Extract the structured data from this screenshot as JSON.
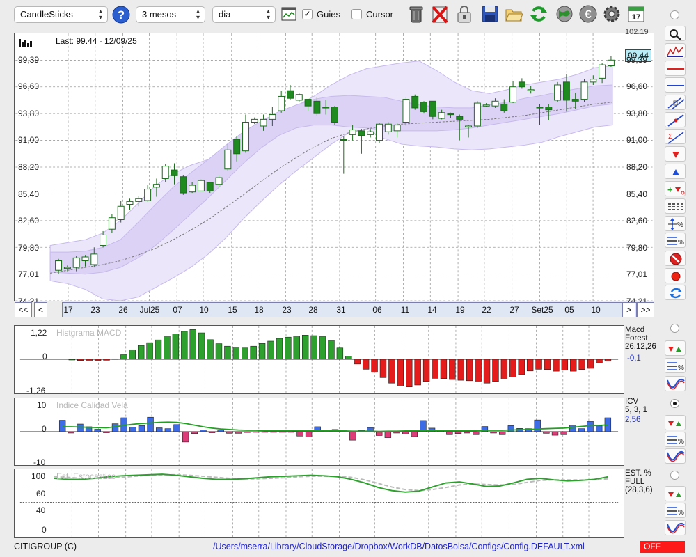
{
  "toolbar": {
    "chart_type": "CandleSticks",
    "period": "3 mesos",
    "interval": "dia",
    "guides_label": "Guies",
    "guides_checked": true,
    "cursor_label": "Cursor",
    "cursor_checked": false,
    "icons": [
      "help-icon",
      "chart-window-icon",
      "trash-icon",
      "delete-icon",
      "lock-icon",
      "save-icon",
      "open-folder-icon",
      "refresh-icon",
      "globe-icon",
      "euro-icon",
      "gear-icon",
      "calendar-icon"
    ],
    "calendar_day": "17"
  },
  "price_chart": {
    "last_info": "Last: 99.44 - 12/09/25",
    "current_value": "99,44",
    "top_cut_label": "102,19",
    "y_labels": [
      "99,39",
      "96,60",
      "93,80",
      "91,00",
      "88,20",
      "85,40",
      "82,60",
      "79,80",
      "77,01",
      "74,21"
    ],
    "ylim": [
      74.21,
      102.19
    ],
    "x_labels": [
      "17",
      "23",
      "26",
      "Jul25",
      "07",
      "10",
      "15",
      "18",
      "23",
      "28",
      "31",
      "06",
      "11",
      "14",
      "19",
      "22",
      "27",
      "Set25",
      "05",
      "10"
    ],
    "nav": {
      "first": "<<",
      "prev": "<",
      "next": ">",
      "last": ">>"
    },
    "candles": [
      {
        "o": 77.4,
        "h": 78.6,
        "l": 77.0,
        "c": 78.4
      },
      {
        "o": 77.6,
        "h": 77.9,
        "l": 77.3,
        "c": 77.7
      },
      {
        "o": 77.7,
        "h": 78.9,
        "l": 77.3,
        "c": 78.7
      },
      {
        "o": 78.4,
        "h": 79.0,
        "l": 77.8,
        "c": 78.8
      },
      {
        "o": 78.0,
        "h": 79.8,
        "l": 77.7,
        "c": 79.1
      },
      {
        "o": 80.0,
        "h": 81.5,
        "l": 79.8,
        "c": 81.1
      },
      {
        "o": 81.7,
        "h": 83.3,
        "l": 81.3,
        "c": 82.9
      },
      {
        "o": 82.7,
        "h": 84.7,
        "l": 82.4,
        "c": 84.1
      },
      {
        "o": 84.3,
        "h": 84.9,
        "l": 83.7,
        "c": 84.6
      },
      {
        "o": 84.6,
        "h": 85.2,
        "l": 84.1,
        "c": 84.9
      },
      {
        "o": 84.7,
        "h": 86.3,
        "l": 84.6,
        "c": 85.9
      },
      {
        "o": 86.1,
        "h": 87.0,
        "l": 85.1,
        "c": 86.4
      },
      {
        "o": 87.0,
        "h": 88.5,
        "l": 86.6,
        "c": 88.3
      },
      {
        "o": 87.9,
        "h": 88.6,
        "l": 86.4,
        "c": 87.3
      },
      {
        "o": 87.2,
        "h": 87.4,
        "l": 85.3,
        "c": 85.5
      },
      {
        "o": 85.6,
        "h": 86.6,
        "l": 85.5,
        "c": 86.3
      },
      {
        "o": 85.7,
        "h": 86.9,
        "l": 85.7,
        "c": 86.8
      },
      {
        "o": 86.6,
        "h": 86.6,
        "l": 85.5,
        "c": 85.7
      },
      {
        "o": 86.4,
        "h": 87.3,
        "l": 86.1,
        "c": 87.1
      },
      {
        "o": 88.0,
        "h": 90.6,
        "l": 87.8,
        "c": 90.0
      },
      {
        "o": 91.1,
        "h": 91.4,
        "l": 88.8,
        "c": 89.6
      },
      {
        "o": 89.9,
        "h": 93.7,
        "l": 89.7,
        "c": 92.9
      },
      {
        "o": 92.9,
        "h": 93.4,
        "l": 92.7,
        "c": 93.2
      },
      {
        "o": 92.5,
        "h": 93.7,
        "l": 92.0,
        "c": 93.2
      },
      {
        "o": 93.2,
        "h": 94.5,
        "l": 92.5,
        "c": 93.7
      },
      {
        "o": 94.1,
        "h": 96.2,
        "l": 93.9,
        "c": 95.6
      },
      {
        "o": 96.2,
        "h": 96.8,
        "l": 95.2,
        "c": 95.4
      },
      {
        "o": 95.2,
        "h": 96.0,
        "l": 95.0,
        "c": 95.8
      },
      {
        "o": 95.3,
        "h": 95.3,
        "l": 94.1,
        "c": 94.6
      },
      {
        "o": 95.1,
        "h": 95.5,
        "l": 93.6,
        "c": 93.8
      },
      {
        "o": 94.5,
        "h": 95.2,
        "l": 93.7,
        "c": 94.4
      },
      {
        "o": 94.5,
        "h": 94.6,
        "l": 92.6,
        "c": 92.9
      },
      {
        "o": 91.1,
        "h": 91.4,
        "l": 87.5,
        "c": 91.0
      },
      {
        "o": 91.6,
        "h": 92.6,
        "l": 91.0,
        "c": 92.1
      },
      {
        "o": 92.0,
        "h": 92.2,
        "l": 89.6,
        "c": 91.5
      },
      {
        "o": 91.6,
        "h": 92.2,
        "l": 91.3,
        "c": 91.9
      },
      {
        "o": 91.0,
        "h": 92.8,
        "l": 90.7,
        "c": 92.7
      },
      {
        "o": 91.9,
        "h": 92.9,
        "l": 91.6,
        "c": 92.7
      },
      {
        "o": 92.0,
        "h": 92.8,
        "l": 91.3,
        "c": 92.6
      },
      {
        "o": 92.9,
        "h": 95.5,
        "l": 92.5,
        "c": 95.3
      },
      {
        "o": 95.6,
        "h": 95.8,
        "l": 94.2,
        "c": 94.4
      },
      {
        "o": 95.0,
        "h": 95.1,
        "l": 93.8,
        "c": 94.0
      },
      {
        "o": 95.1,
        "h": 95.1,
        "l": 93.2,
        "c": 93.5
      },
      {
        "o": 93.3,
        "h": 94.2,
        "l": 93.2,
        "c": 93.9
      },
      {
        "o": 93.8,
        "h": 93.9,
        "l": 93.3,
        "c": 93.7
      },
      {
        "o": 93.5,
        "h": 93.7,
        "l": 91.0,
        "c": 93.2
      },
      {
        "o": 92.4,
        "h": 92.6,
        "l": 91.3,
        "c": 92.5
      },
      {
        "o": 92.5,
        "h": 95.1,
        "l": 92.3,
        "c": 94.9
      },
      {
        "o": 94.6,
        "h": 94.9,
        "l": 94.5,
        "c": 94.7
      },
      {
        "o": 94.6,
        "h": 95.4,
        "l": 94.4,
        "c": 95.1
      },
      {
        "o": 94.8,
        "h": 95.3,
        "l": 93.9,
        "c": 94.1
      },
      {
        "o": 95.0,
        "h": 97.2,
        "l": 94.9,
        "c": 96.6
      },
      {
        "o": 97.1,
        "h": 97.5,
        "l": 96.4,
        "c": 96.6
      },
      {
        "o": 96.2,
        "h": 96.7,
        "l": 95.9,
        "c": 96.3
      },
      {
        "o": 94.5,
        "h": 94.8,
        "l": 92.6,
        "c": 94.4
      },
      {
        "o": 94.5,
        "h": 94.8,
        "l": 93.1,
        "c": 94.2
      },
      {
        "o": 95.2,
        "h": 97.1,
        "l": 95.0,
        "c": 96.8
      },
      {
        "o": 97.1,
        "h": 97.9,
        "l": 94.0,
        "c": 95.2
      },
      {
        "o": 95.3,
        "h": 96.0,
        "l": 94.3,
        "c": 95.1
      },
      {
        "o": 95.3,
        "h": 97.4,
        "l": 95.0,
        "c": 97.1
      },
      {
        "o": 97.1,
        "h": 97.8,
        "l": 96.8,
        "c": 97.4
      },
      {
        "o": 97.5,
        "h": 99.1,
        "l": 97.0,
        "c": 98.9
      },
      {
        "o": 98.8,
        "h": 99.8,
        "l": 98.7,
        "c": 99.4
      }
    ],
    "band_upper": [
      80.0,
      80.3,
      80.6,
      81.3,
      82.6,
      84.4,
      86.3,
      87.5,
      88.4,
      89.0,
      89.8,
      91.0,
      92.3,
      93.6,
      94.6,
      95.6,
      96.8,
      97.8,
      98.5,
      98.8,
      99.1,
      99.3,
      98.3,
      97.1,
      96.2,
      95.9,
      96.3,
      96.8,
      97.1,
      97.4,
      97.9,
      98.6,
      98.8
    ],
    "band_lower": [
      76.3,
      76.0,
      75.4,
      74.4,
      74.2,
      74.6,
      75.6,
      76.6,
      77.7,
      79.1,
      80.8,
      82.8,
      84.6,
      86.3,
      87.8,
      89.2,
      90.6,
      91.8,
      92.2,
      91.2,
      90.6,
      90.4,
      90.3,
      90.1,
      90.0,
      90.1,
      90.3,
      90.5,
      90.8,
      91.4,
      91.9,
      92.4,
      92.6
    ],
    "band_inner_upper": [
      79.3,
      79.3,
      79.4,
      79.8,
      80.6,
      82.4,
      84.3,
      86.1,
      87.6,
      89.0,
      90.5,
      91.9,
      93.0,
      94.0,
      94.7,
      95.3,
      95.6,
      95.7,
      95.6,
      95.5,
      95.1,
      94.7,
      94.5,
      94.4,
      94.4,
      94.7,
      95.0,
      95.4,
      95.7,
      96.1,
      96.4,
      96.7,
      96.8
    ],
    "band_inner_lower": [
      77.2,
      77.1,
      77.0,
      77.2,
      77.7,
      78.7,
      80.0,
      81.6,
      83.3,
      85.0,
      86.8,
      88.6,
      90.2,
      91.5,
      92.3,
      92.6,
      92.6,
      92.4,
      92.3,
      92.1,
      92.0,
      92.0,
      92.0,
      92.1,
      92.3,
      92.6,
      92.9,
      93.2,
      93.5,
      93.8,
      94.2,
      94.6,
      94.8
    ],
    "ma_line": [
      77.1,
      77.4,
      77.7,
      78.0,
      78.4,
      79.0,
      79.7,
      80.6,
      81.6,
      82.7,
      84.0,
      85.3,
      86.7,
      88.0,
      89.2,
      90.3,
      91.2,
      91.8,
      92.2,
      92.5,
      92.7,
      92.8,
      92.9,
      93.0,
      93.1,
      93.2,
      93.4,
      93.6,
      93.9,
      94.2,
      94.5,
      94.8,
      95.0
    ]
  },
  "macd": {
    "title": "Histgrama MACD",
    "info": [
      "Macd",
      "Forest",
      "26,12,26"
    ],
    "value": "-0,1",
    "y_labels": [
      "1,22",
      "0",
      "-1,26"
    ],
    "ylim": [
      -1.26,
      1.22
    ],
    "values": [
      0.0,
      -0.05,
      -0.07,
      -0.06,
      -0.04,
      0.02,
      0.18,
      0.38,
      0.55,
      0.66,
      0.77,
      0.92,
      1.01,
      1.11,
      1.18,
      1.05,
      0.78,
      0.62,
      0.52,
      0.48,
      0.45,
      0.52,
      0.63,
      0.72,
      0.83,
      0.88,
      0.92,
      0.96,
      0.94,
      0.9,
      0.75,
      0.45,
      0.12,
      -0.2,
      -0.42,
      -0.55,
      -0.77,
      -1.0,
      -1.12,
      -1.16,
      -1.08,
      -0.93,
      -0.8,
      -0.81,
      -0.85,
      -0.88,
      -0.9,
      -0.92,
      -1.0,
      -0.93,
      -0.83,
      -0.74,
      -0.64,
      -0.49,
      -0.42,
      -0.43,
      -0.5,
      -0.46,
      -0.5,
      -0.43,
      -0.38,
      -0.15,
      -0.08
    ]
  },
  "icv": {
    "title": "Indice Calidad Vela",
    "info": [
      "ICV",
      "5, 3, 1"
    ],
    "value": "2,56",
    "y_labels": [
      "10",
      "0",
      "-10"
    ],
    "ylim": [
      -10,
      10
    ],
    "values": [
      4.2,
      -0.5,
      2.8,
      1.8,
      0.9,
      -0.4,
      2.9,
      5.1,
      1.6,
      2.2,
      5.3,
      1.4,
      1.1,
      2.6,
      -3.8,
      -0.7,
      0.6,
      -0.4,
      0.7,
      -0.6,
      -0.6,
      -0.3,
      -0.1,
      -0.2,
      -0.1,
      -0.1,
      -0.1,
      -1.6,
      -1.9,
      1.8,
      0.6,
      0.8,
      0.6,
      -3.1,
      0.5,
      1.5,
      -1.4,
      -2.2,
      -0.5,
      -0.8,
      -1.8,
      4.1,
      1.3,
      0.6,
      -1.1,
      -0.7,
      -0.5,
      -1.1,
      1.9,
      -0.5,
      -1.1,
      2.2,
      1.2,
      1.1,
      4.3,
      -0.6,
      -1.3,
      -1.1,
      2.4,
      1.1,
      3.8,
      2.1,
      5.1
    ],
    "signal": [
      1.8,
      1.8,
      1.7,
      1.6,
      1.5,
      1.4,
      1.8,
      2.3,
      2.7,
      3.0,
      3.2,
      3.4,
      3.5,
      3.4,
      3.0,
      2.4,
      1.8,
      1.3,
      1.0,
      0.8,
      0.6,
      0.5,
      0.5,
      0.4,
      0.4,
      0.4,
      0.4,
      0.3,
      0.3,
      0.3,
      0.3,
      0.3,
      0.3,
      0.2,
      0.2,
      0.2,
      0.1,
      0.2,
      0.2,
      0.3,
      0.3,
      0.4,
      0.4,
      0.4,
      0.4,
      0.4,
      0.4,
      0.4,
      0.5,
      0.5,
      0.5,
      0.6,
      0.7,
      0.8,
      1.0,
      1.1,
      1.2,
      1.3,
      1.6,
      1.9,
      2.2,
      2.3,
      2.5
    ]
  },
  "stochastic": {
    "title": "Est. Estocastico",
    "info": [
      "EST. %",
      "FULL",
      "(28,3,6)"
    ],
    "y_labels": [
      "100",
      "60",
      "40",
      "0"
    ],
    "ylim": [
      0,
      120
    ],
    "levels": [
      80,
      50
    ],
    "k": [
      97,
      95,
      95,
      97,
      100,
      102,
      103,
      104,
      105,
      103,
      100,
      97,
      95,
      95,
      96,
      98,
      100,
      101,
      102,
      103,
      102,
      100,
      95,
      88,
      79,
      73,
      70,
      72,
      80,
      88,
      90,
      86,
      81,
      82,
      88,
      95,
      97,
      94,
      92,
      93,
      95,
      100
    ],
    "d": [
      100,
      99,
      97,
      97,
      97,
      99,
      101,
      103,
      104,
      104,
      103,
      101,
      99,
      97,
      96,
      96,
      97,
      98,
      100,
      101,
      101,
      101,
      99,
      94,
      87,
      80,
      75,
      73,
      75,
      79,
      84,
      86,
      85,
      84,
      85,
      89,
      93,
      94,
      94,
      94,
      94,
      96
    ]
  },
  "side_icons": [
    "zoom-icon",
    "price-chart-icon",
    "horizontal-red-line-icon",
    "horizontal-blue-line-icon",
    "trend-channel-icon",
    "trend-line-icon",
    "fibonacci-icon",
    "arrow-down-icon",
    "arrow-up-icon",
    "buy-sell-icon",
    "table-icon",
    "percent-scale-icon",
    "percent-lines-icon",
    "cancel-icon",
    "record-icon",
    "sync-icon"
  ],
  "status": {
    "symbol": "CITIGROUP (C)",
    "path": "/Users/mserra/Library/CloudStorage/Dropbox/WorkDB/DatosBolsa/Configs/Config.DEFAULT.xml",
    "state": "OFF"
  },
  "colors": {
    "up_fill": "#ffffff",
    "down_fill": "#1f8a1f",
    "candle_border": "#1b6b1b",
    "band_outer": "#ece6fb",
    "band_inner": "#dcd2f6",
    "band_stroke": "#c6b9ec",
    "macd_pos": "#2ea02e",
    "macd_neg": "#e41c1c",
    "icv_pos": "#3d6ce6",
    "icv_neg": "#e03b79",
    "icv_signal": "#22a022",
    "stoch_k": "#2ea02e",
    "stoch_d": "#bbbbbb",
    "value_box": "#b8ecf6",
    "axis_bar": "#dfe7f5"
  }
}
